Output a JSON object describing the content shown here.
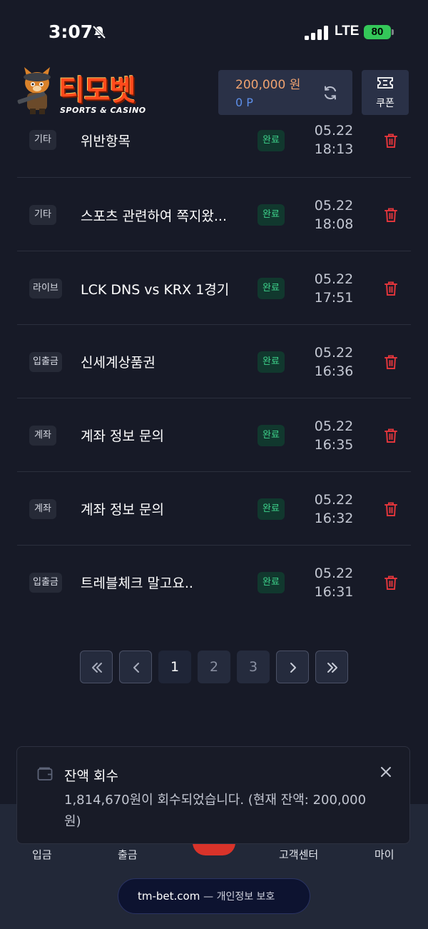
{
  "status_bar": {
    "time": "3:07",
    "network": "LTE",
    "battery": "80"
  },
  "header": {
    "logo_title": "티모벳",
    "logo_subtitle": "SPORTS & CASINO",
    "balance": "200,000 원",
    "points": "0 P",
    "coupon_label": "쿠폰"
  },
  "inquiries": [
    {
      "category": "기타",
      "title": "위반항목",
      "status": "완료",
      "date": "05.22",
      "time": "18:13"
    },
    {
      "category": "기타",
      "title": "스포츠 관련하여 쪽지왔...",
      "status": "완료",
      "date": "05.22",
      "time": "18:08"
    },
    {
      "category": "라이브",
      "title": "LCK DNS vs KRX 1경기",
      "status": "완료",
      "date": "05.22",
      "time": "17:51"
    },
    {
      "category": "입출금",
      "title": "신세계상품권",
      "status": "완료",
      "date": "05.22",
      "time": "16:36"
    },
    {
      "category": "계좌",
      "title": "계좌 정보 문의",
      "status": "완료",
      "date": "05.22",
      "time": "16:35"
    },
    {
      "category": "계좌",
      "title": "계좌 정보 문의",
      "status": "완료",
      "date": "05.22",
      "time": "16:32"
    },
    {
      "category": "입출금",
      "title": "트레블체크 말고요..",
      "status": "완료",
      "date": "05.22",
      "time": "16:31"
    }
  ],
  "pagination": {
    "pages": [
      "1",
      "2",
      "3"
    ],
    "current": "1"
  },
  "bottom_nav": {
    "deposit": "입금",
    "withdraw": "출금",
    "support": "고객센터",
    "my": "마이"
  },
  "toast": {
    "title": "잔액 회수",
    "message": "1,814,670원이 회수되었습니다. (현재 잔액: 200,000원)"
  },
  "footer": {
    "url": "tm-bet.com",
    "privacy": "— 개인정보 보호"
  },
  "colors": {
    "background": "#171a27",
    "accent_orange": "#f0a370",
    "points_blue": "#5d8ee8",
    "status_green": "#3ed48c",
    "delete_red": "#e0353b"
  }
}
